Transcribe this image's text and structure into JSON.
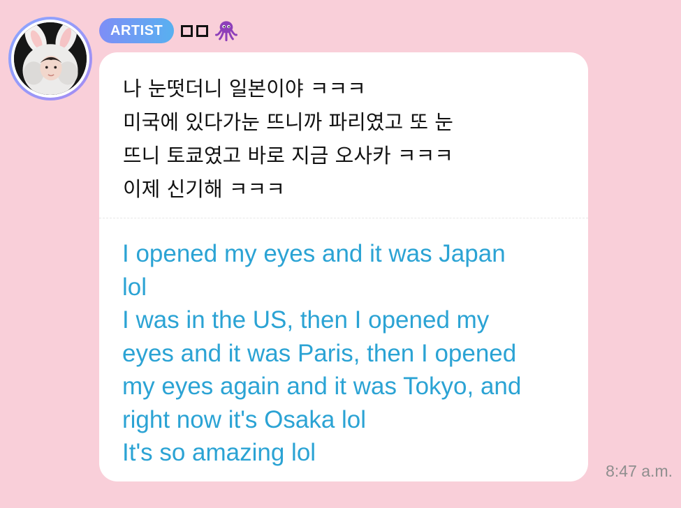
{
  "message": {
    "sender": {
      "badge": "ARTIST",
      "name_icons": [
        "square",
        "square",
        "octopus-emoji"
      ],
      "avatar": "avatar-photo"
    },
    "korean_text": "나 눈떳더니 일본이야 ㅋㅋㅋ\n미국에 있다가눈 뜨니까 파리였고 또 눈\n뜨니 토쿄였고 바로 지금 오사카 ㅋㅋㅋ\n이제 신기해 ㅋㅋㅋ",
    "english_text": "I opened my eyes and it was Japan\nlol\nI was in the US, then I opened my\neyes and it was Paris, then I opened\nmy eyes again and it was Tokyo, and\nright now it's Osaka lol\nIt's so amazing lol",
    "timestamp": "8:47 a.m."
  },
  "colors": {
    "background": "#f9cfd9",
    "bubble": "#ffffff",
    "translation_text": "#2ba3d4",
    "badge_gradient": [
      "#7e8ef6",
      "#58b0f0"
    ]
  }
}
